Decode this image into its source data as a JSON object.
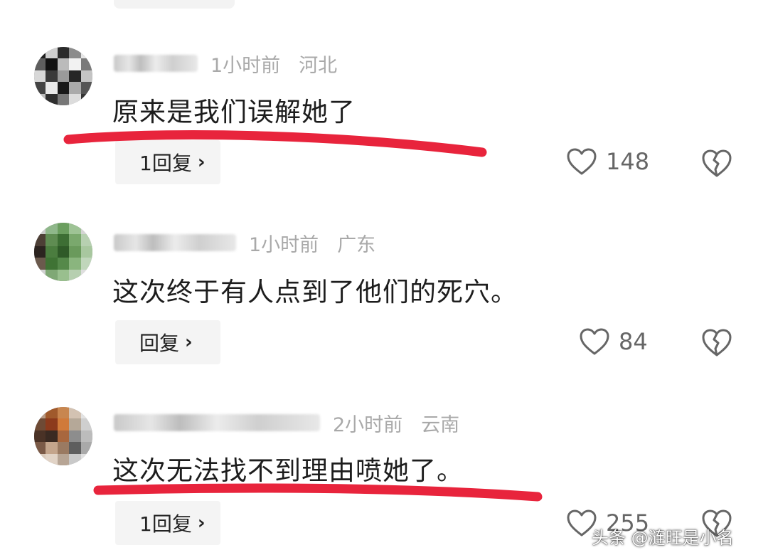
{
  "comments": [
    {
      "time": "1小时前",
      "location": "河北",
      "text": "原来是我们误解她了",
      "reply_label": "1回复",
      "likes": "148",
      "underline_color": "#e8243c"
    },
    {
      "time": "1小时前",
      "location": "广东",
      "text": "这次终于有人点到了他们的死穴。",
      "reply_label": "回复",
      "likes": "84"
    },
    {
      "time": "2小时前",
      "location": "云南",
      "text": "这次无法找不到理由喷她了。",
      "reply_label": "1回复",
      "likes": "255",
      "underline_color": "#e8243c"
    }
  ],
  "reply_chevron": "›",
  "icons": {
    "like": "heart-outline-icon",
    "dislike": "broken-heart-icon"
  },
  "watermark": "头条 @涟旺是小名"
}
